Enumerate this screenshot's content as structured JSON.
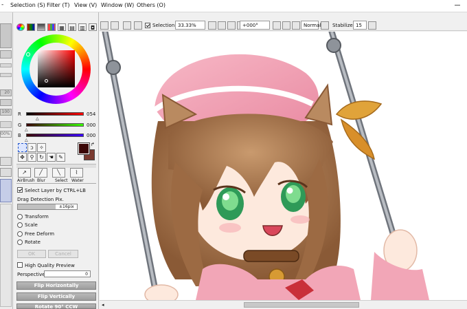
{
  "menu": [
    {
      "label": "Selection (S)"
    },
    {
      "label": "Filter (T)"
    },
    {
      "label": "View (V)"
    },
    {
      "label": "Window (W)"
    },
    {
      "label": "Others (O)"
    }
  ],
  "left_strip": {
    "values": [
      "20",
      "100",
      "00%"
    ]
  },
  "color_panel": {
    "r_label": "R",
    "g_label": "G",
    "b_label": "B",
    "r_value": "054",
    "g_value": "000",
    "b_value": "000",
    "primary_color": "#3a0606",
    "secondary_color": "#7a3a30"
  },
  "brush_tools": [
    {
      "label": "AirBrush"
    },
    {
      "label": "Blur"
    },
    {
      "label": "Select"
    },
    {
      "label": "Water"
    }
  ],
  "options": {
    "select_layer_label": "Select Layer by CTRL+LB",
    "drag_detection_label": "Drag Detection Pix.",
    "drag_detection_value": "±16pix",
    "transform_modes": [
      "Transform",
      "Scale",
      "Free Deform",
      "Rotate"
    ],
    "ok_label": "OK",
    "cancel_label": "Cancel",
    "hq_preview_label": "High Quality Preview",
    "perspective_label": "Perspective",
    "perspective_value": "0",
    "flip_h": "Flip Horizontally",
    "flip_v": "Flip Vertically",
    "rotate": "Rotate 90° CCW"
  },
  "toolbar": {
    "selection_label": "Selection",
    "zoom": "33.33%",
    "angle": "+000°",
    "blend": "Normal",
    "stabilizer_label": "Stabilizer",
    "stabilizer_value": "15"
  }
}
